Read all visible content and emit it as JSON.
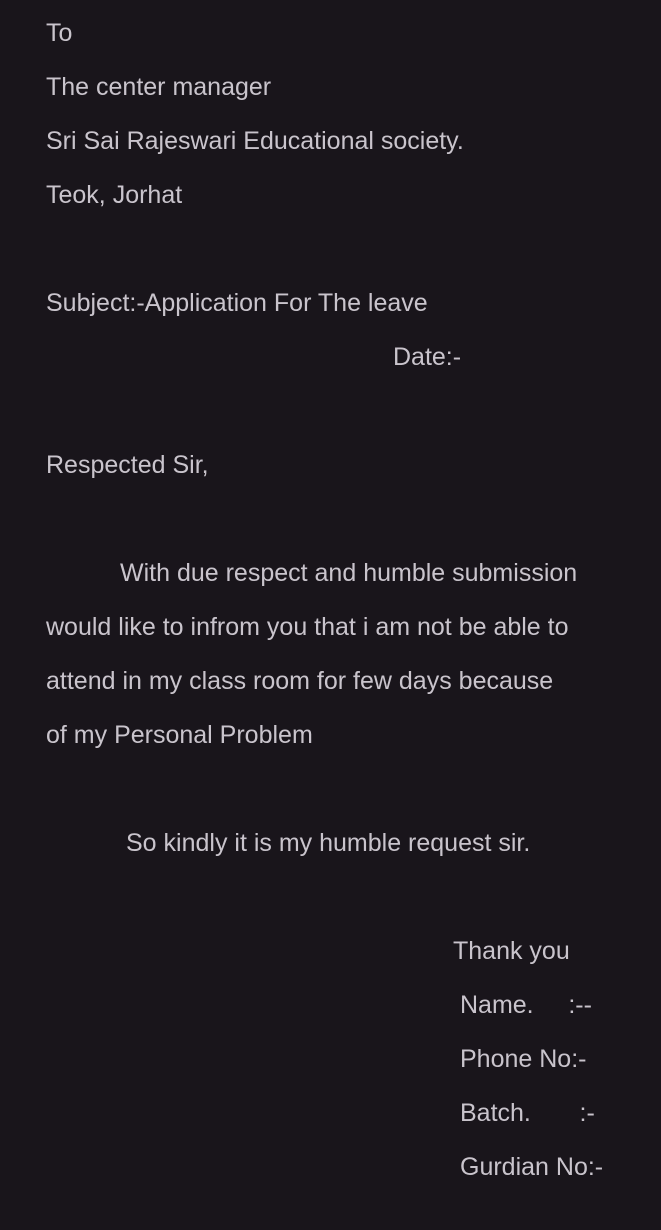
{
  "letter": {
    "to": "To",
    "recipient": "The center manager",
    "organization": "Sri Sai Rajeswari Educational society.",
    "location": "Teok, Jorhat",
    "subject": "Subject:-Application For The leave",
    "date": "Date:-",
    "salutation": "Respected Sir,",
    "body_lines": [
      "With due respect and humble submission",
      "would like to infrom you that i am not be able to",
      "attend in my class room for few days because",
      "of my Personal Problem"
    ],
    "request": "So kindly it is my humble request sir.",
    "closing": "Thank you",
    "name_label": "Name.     :--",
    "phone_label": "Phone No:-",
    "batch_label": "Batch.       :-",
    "guardian_label": "Gurdian No:-"
  }
}
